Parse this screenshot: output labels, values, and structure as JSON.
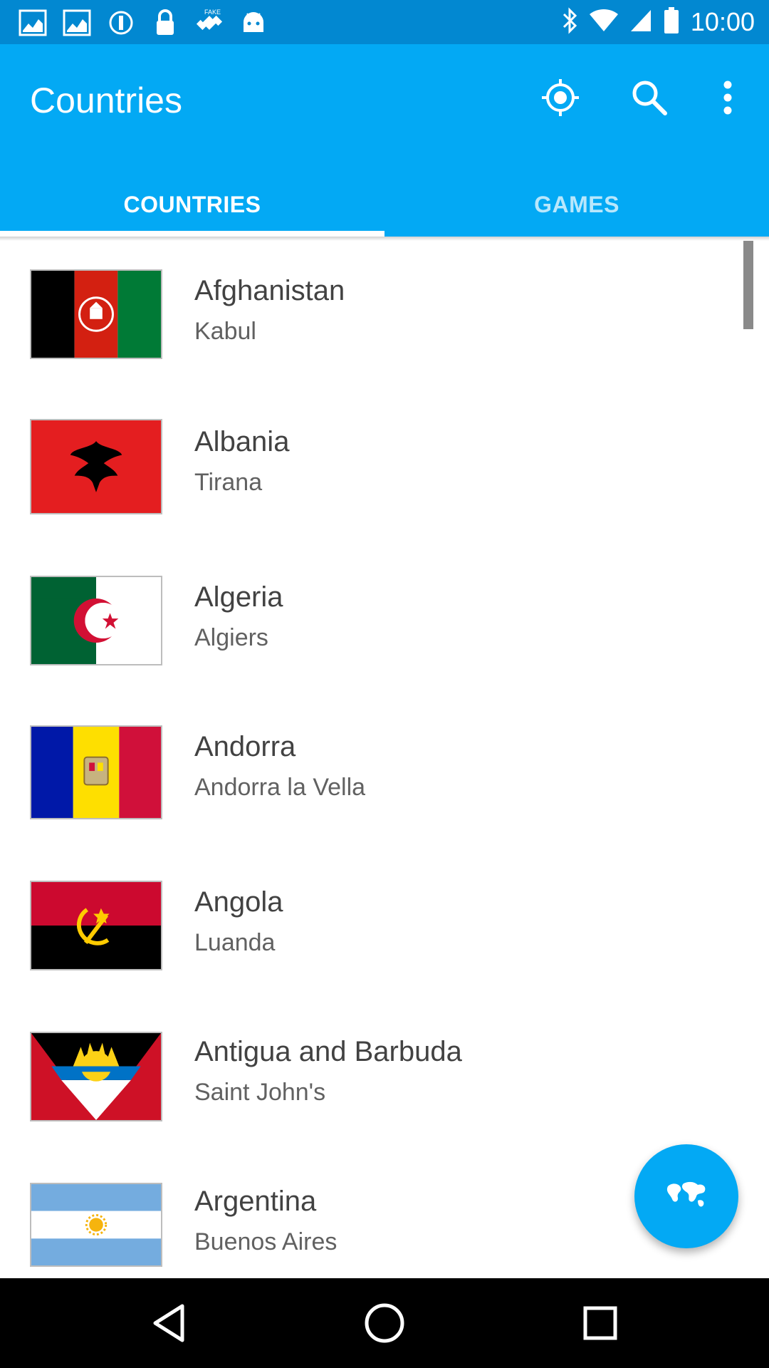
{
  "status_bar": {
    "time": "10:00",
    "left_icons": [
      "market-app-icon",
      "market-app-icon",
      "data-saver-icon",
      "lock-icon",
      "fake-gps-icon",
      "android-robot-icon"
    ],
    "right_icons": [
      "bluetooth-icon",
      "wifi-icon",
      "signal-icon",
      "battery-icon"
    ]
  },
  "app_bar": {
    "title": "Countries",
    "actions": [
      "my-location-icon",
      "search-icon",
      "more-vert-icon"
    ],
    "color": "#03A9F4"
  },
  "tabs": [
    {
      "label": "COUNTRIES",
      "selected": true
    },
    {
      "label": "GAMES",
      "selected": false
    }
  ],
  "countries": [
    {
      "name": "Afghanistan",
      "capital": "Kabul",
      "flag": "afghanistan-flag"
    },
    {
      "name": "Albania",
      "capital": "Tirana",
      "flag": "albania-flag"
    },
    {
      "name": "Algeria",
      "capital": "Algiers",
      "flag": "algeria-flag"
    },
    {
      "name": "Andorra",
      "capital": "Andorra la Vella",
      "flag": "andorra-flag"
    },
    {
      "name": "Angola",
      "capital": "Luanda",
      "flag": "angola-flag"
    },
    {
      "name": "Antigua and Barbuda",
      "capital": "Saint John's",
      "flag": "antigua-flag"
    },
    {
      "name": "Argentina",
      "capital": "Buenos Aires",
      "flag": "argentina-flag"
    }
  ],
  "fab": {
    "icon": "world-map-icon"
  },
  "nav_bar": {
    "buttons": [
      "back-icon",
      "home-icon",
      "recents-icon"
    ]
  }
}
